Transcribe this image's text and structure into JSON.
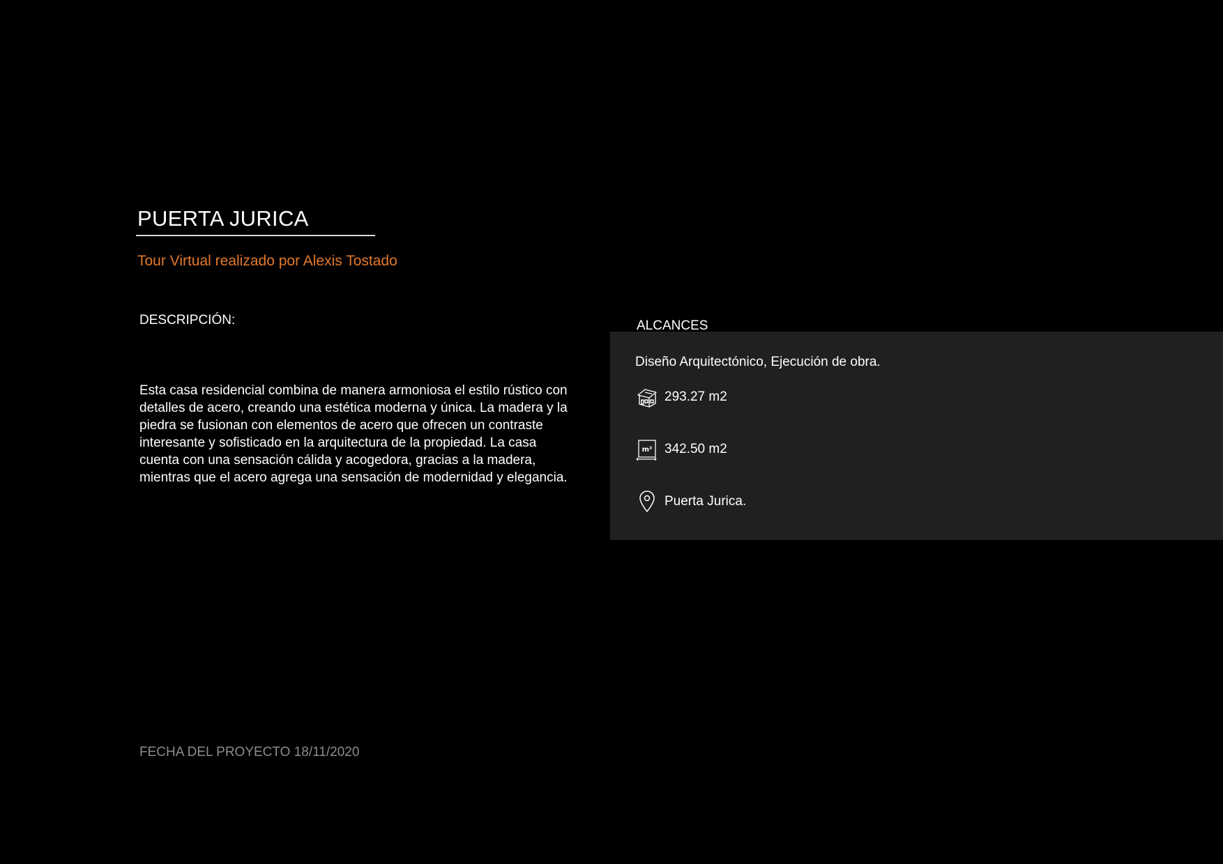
{
  "header": {
    "title": "PUERTA JURICA",
    "subtitle": "Tour Virtual realizado por Alexis Tostado"
  },
  "description": {
    "heading": "DESCRIPCIÓN:",
    "lines": [
      "Esta casa residencial combina de manera armoniosa el estilo rústico con",
      "detalles de acero, creando una estética moderna y única. La madera y la",
      "piedra se fusionan con elementos de acero que ofrecen un contraste",
      "interesante y sofisticado en la arquitectura de la propiedad. La casa",
      "cuenta con una sensación cálida y acogedora, gracias a la madera,",
      "mientras que el acero agrega una sensación de modernidad y elegancia."
    ]
  },
  "footer": {
    "date_text": "FECHA DEL PROYECTO 18/11/2020"
  },
  "scope": {
    "heading": "ALCANCES",
    "services": "Diseño Arquitectónico, Ejecución de obra.",
    "built_area": "293.27 m2",
    "lot_icon_label": "m²",
    "lot_area": "342.50 m2",
    "location": "Puerta Jurica."
  },
  "colors": {
    "background": "#000000",
    "panel": "#202020",
    "accent": "#e3792d",
    "muted": "#8c8c8c",
    "text": "#ffffff"
  },
  "icons": {
    "built_area": "house-icon",
    "lot_area": "area-icon",
    "location": "location-pin-icon"
  }
}
